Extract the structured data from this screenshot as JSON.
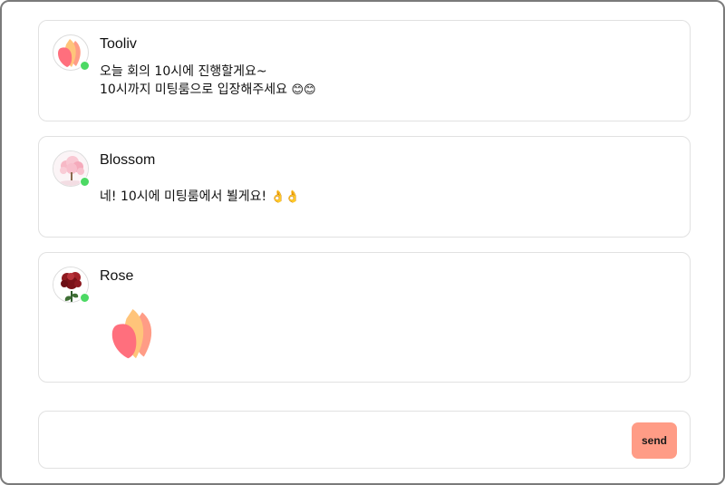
{
  "messages": [
    {
      "sender": "Tooliv",
      "avatar": "tooliv-logo-icon",
      "online": true,
      "lines": [
        "오늘 회의 10시에 진행할게요~",
        "10시까지 미팅룸으로 입장해주세요"
      ],
      "emoji": "😊😊"
    },
    {
      "sender": "Blossom",
      "avatar": "cherry-blossom-icon",
      "online": true,
      "lines": [
        "네! 10시에 미팅룸에서 뵐게요!"
      ],
      "emoji": "👌👌"
    },
    {
      "sender": "Rose",
      "avatar": "rose-icon",
      "online": true,
      "lines": [],
      "sticker": "tooliv-logo-sticker"
    }
  ],
  "composer": {
    "placeholder": "",
    "value": "",
    "send_label": "send"
  },
  "colors": {
    "online": "#4cd964",
    "send_button": "#ff9c86",
    "border": "#e1e1e1"
  }
}
